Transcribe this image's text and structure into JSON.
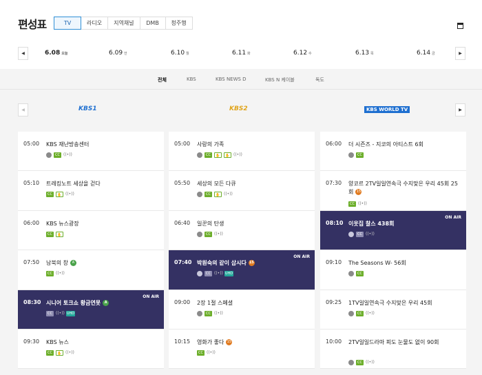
{
  "header": {
    "title": "편성표",
    "tabs": [
      "TV",
      "라디오",
      "지역채널",
      "DMB",
      "청주행"
    ]
  },
  "dates": [
    {
      "date": "6.08",
      "dow": "오늘"
    },
    {
      "date": "6.09",
      "dow": "언"
    },
    {
      "date": "6.10",
      "dow": "월"
    },
    {
      "date": "6.11",
      "dow": "화"
    },
    {
      "date": "6.12",
      "dow": "수"
    },
    {
      "date": "6.13",
      "dow": "목"
    },
    {
      "date": "6.14",
      "dow": "금"
    }
  ],
  "subtabs": [
    "전체",
    "KBS",
    "KBS NEWS D",
    "KBS N 케이블",
    "독도"
  ],
  "channels": [
    "KBS1",
    "KBS2",
    "KBS WORLD TV"
  ],
  "onair_label": "ON AIR",
  "columns": [
    [
      {
        "time": "05:00",
        "title": "KBS 재난방송센터",
        "badges": [
          "circ",
          "cc",
          "radio"
        ]
      },
      {
        "time": "05:10",
        "title": "트레킹노트 세상을 걷다",
        "badges": [
          "cc",
          "ico",
          "radio"
        ]
      },
      {
        "time": "06:00",
        "title": "KBS 뉴스광장",
        "badges": [
          "cc",
          "ico"
        ]
      },
      {
        "time": "07:50",
        "title": "남북의 창",
        "age": "g",
        "badges": [
          "cc",
          "radio"
        ]
      },
      {
        "time": "08:30",
        "title": "시니어 토크쇼 황금연못",
        "age": "g",
        "onair": true,
        "badges": [
          "cc",
          "radio",
          "uhd"
        ]
      },
      {
        "time": "09:30",
        "title": "KBS 뉴스",
        "badges": [
          "cc",
          "ico",
          "radio"
        ]
      }
    ],
    [
      {
        "time": "05:00",
        "title": "사랑의 가족",
        "badges": [
          "circ",
          "cc",
          "ico",
          "ico",
          "radio"
        ]
      },
      {
        "time": "05:50",
        "title": "세상의 모든 다큐",
        "badges": [
          "circ",
          "cc",
          "ico",
          "radio"
        ]
      },
      {
        "time": "06:40",
        "title": "일꾼의 탄생",
        "badges": [
          "circ",
          "cc",
          "radio"
        ]
      },
      {
        "time": "07:40",
        "title": "박원숙의 같이 삽시다",
        "age": "o",
        "onair": true,
        "badges": [
          "circ",
          "cc",
          "radio",
          "uhd"
        ]
      },
      {
        "time": "09:00",
        "title": "2장 1절 스페셜",
        "badges": [
          "circ",
          "cc",
          "radio"
        ]
      },
      {
        "time": "10:15",
        "title": "영화가 좋다",
        "age": "o",
        "badges": [
          "cc",
          "radio"
        ]
      }
    ],
    [
      {
        "time": "06:00",
        "title": "더 시즌즈 - 지코의 아티스트 6회",
        "badges": [
          "circ",
          "cc"
        ]
      },
      {
        "time": "07:30",
        "title": "양코르 2TV일일연속극 수지맞은 우리 45회 25회",
        "age": "o",
        "badges": [
          "cc",
          "radio"
        ],
        "multiline": true
      },
      {
        "time": "08:10",
        "title": "이웃집 찰스 438회",
        "onair": true,
        "badges": [
          "circ",
          "cc",
          "radio"
        ]
      },
      {
        "time": "09:10",
        "title": "The Seasons W- 56회",
        "badges": [
          "circ",
          "cc"
        ]
      },
      {
        "time": "09:25",
        "title": "1TV일일연속극 수지맞은 우리 45회",
        "badges": [
          "circ",
          "cc",
          "radio"
        ]
      },
      {
        "time": "10:00",
        "title": "2TV일일드라마 피도 눈물도 없이 90회",
        "badges": [
          "circ",
          "cc",
          "radio"
        ],
        "multiline": true
      }
    ]
  ]
}
